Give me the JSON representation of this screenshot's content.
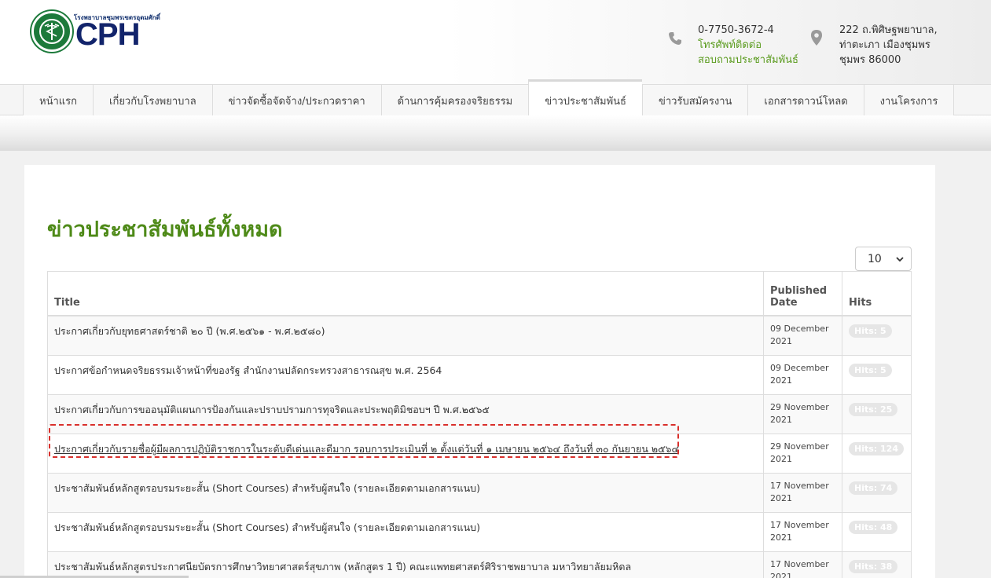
{
  "header": {
    "logo_small_text": "โรงพยาบาลชุมพรเขตรอุดมศักดิ์",
    "logo_text": "CPH",
    "phone": "0-7750-3672-4",
    "phone_label_1": "โทรศัพท์ติดต่อ",
    "phone_label_2": "สอบถามประชาสัมพันธ์",
    "address_1": "222 ถ.พิศิษฐพยาบาล,",
    "address_2": "ท่าตะเภา เมืองชุมพร",
    "address_3": "ชุมพร 86000"
  },
  "nav": {
    "items": [
      {
        "label": "หน้าแรก"
      },
      {
        "label": "เกี่ยวกับโรงพยาบาล"
      },
      {
        "label": "ข่าวจัดซื้อจัดจ้าง/ประกวดราคา"
      },
      {
        "label": "ด้านการคุ้มครองจริยธรรม"
      },
      {
        "label": "ข่าวประชาสัมพันธ์"
      },
      {
        "label": "ข่าวรับสมัครงาน"
      },
      {
        "label": "เอกสารดาวน์โหลด"
      },
      {
        "label": "งานโครงการ"
      }
    ],
    "active_index": 4
  },
  "main": {
    "title": "ข่าวประชาสัมพันธ์ทั้งหมด",
    "limit_value": "10",
    "columns": {
      "title": "Title",
      "date_1": "Published",
      "date_2": "Date",
      "hits": "Hits"
    },
    "rows": [
      {
        "title": "ประกาศเกี่ยวกับยุทธศาสตร์ชาติ ๒๐ ปี (พ.ศ.๒๕๖๑ - พ.ศ.๒๕๘๐)",
        "date_1": "09 December",
        "date_2": "2021",
        "hits": "Hits: 5"
      },
      {
        "title": "ประกาศข้อกำหนดจริยธรรมเจ้าหน้าที่ของรัฐ สำนักงานปลัดกระทรวงสาธารณสุข พ.ศ. 2564",
        "date_1": "09 December",
        "date_2": "2021",
        "hits": "Hits: 5"
      },
      {
        "title": "ประกาศเกี่ยวกับการขออนุมัติแผนการป้องกันและปราบปรามการทุจริตและประพฤติมิชอบฯ ปี พ.ศ.๒๕๖๕",
        "date_1": "29 November",
        "date_2": "2021",
        "hits": "Hits: 25"
      },
      {
        "title": "ประกาศเกี่ยวกับรายชื่อผู้มีผลการปฏิบัติราชการในระดับดีเด่นและดีมาก รอบการประเมินที่ ๒ ตั้งแต่วันที่ ๑ เมษายน ๒๕๖๔ ถึงวันที่ ๓๐ กันยายน ๒๕๖๔",
        "date_1": "29 November",
        "date_2": "2021",
        "hits": "Hits: 124"
      },
      {
        "title": "ประชาสัมพันธ์หลักสูตรอบรมระยะสั้น (Short Courses) สำหรับผู้สนใจ (รายละเอียดตามเอกสารแนบ)",
        "date_1": "17 November",
        "date_2": "2021",
        "hits": "Hits: 74"
      },
      {
        "title": "ประชาสัมพันธ์หลักสูตรอบรมระยะสั้น (Short Courses) สำหรับผู้สนใจ (รายละเอียดตามเอกสารแนบ)",
        "date_1": "17 November",
        "date_2": "2021",
        "hits": "Hits: 48"
      },
      {
        "title": "ประชาสัมพันธ์หลักสูตรประกาศนียบัตรการศึกษาวิทยาศาสตร์สุขภาพ (หลักสูตร 1 ปี) คณะแพทยศาสตร์ศิริราชพยาบาล มหาวิทยาลัยมหิดล",
        "date_1": "17 November",
        "date_2": "2021",
        "hits": "Hits: 38"
      }
    ]
  },
  "icons": {
    "phone": "phone-icon",
    "location": "map-pin-icon",
    "logo_seal": "ministry-seal-icon",
    "select_chevron": "chevron-down-icon"
  },
  "colors": {
    "accent_green": "#4e8a18",
    "logo_navy": "#12246b",
    "highlight_red": "#d9302c"
  }
}
